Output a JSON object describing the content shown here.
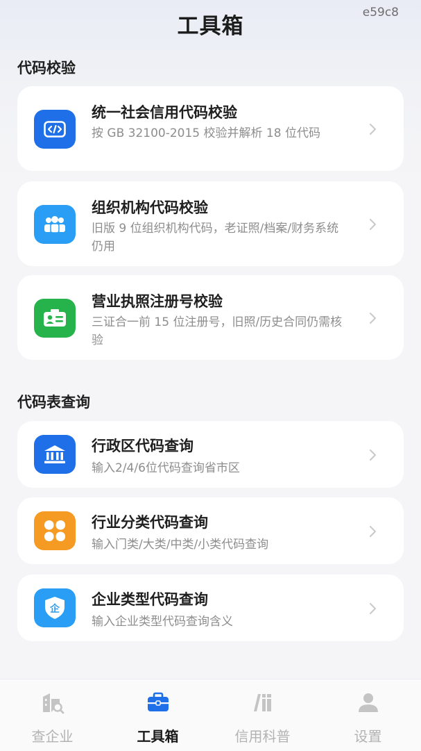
{
  "header": {
    "title": "工具箱",
    "corner_code": "e59c8"
  },
  "sections": [
    {
      "title": "代码校验",
      "items": [
        {
          "title": "统一社会信用代码校验",
          "desc": "按 GB 32100-2015 校验并解析 18 位代码",
          "icon": "code-icon"
        },
        {
          "title": "组织机构代码校验",
          "desc": "旧版 9 位组织机构代码，老证照/档案/财务系统仍用",
          "icon": "users-icon"
        },
        {
          "title": "营业执照注册号校验",
          "desc": "三证合一前 15 位注册号，旧照/历史合同仍需核验",
          "icon": "id-card-icon"
        }
      ]
    },
    {
      "title": "代码表查询",
      "items": [
        {
          "title": "行政区代码查询",
          "desc": "输入2/4/6位代码查询省市区",
          "icon": "government-icon"
        },
        {
          "title": "行业分类代码查询",
          "desc": "输入门类/大类/中类/小类代码查询",
          "icon": "category-icon"
        },
        {
          "title": "企业类型代码查询",
          "desc": "输入企业类型代码查询含义",
          "icon": "shield-enterprise-icon"
        }
      ]
    }
  ],
  "icon_labels": {
    "enterprise_glyph": "企"
  },
  "tabs": [
    {
      "label": "查企业",
      "icon": "search-company-icon",
      "active": false
    },
    {
      "label": "工具箱",
      "icon": "toolbox-icon",
      "active": true
    },
    {
      "label": "信用科普",
      "icon": "books-icon",
      "active": false
    },
    {
      "label": "设置",
      "icon": "user-icon",
      "active": false
    }
  ],
  "colors": {
    "blue": "#1e6fe8",
    "sky": "#2a9df4",
    "green": "#27b34b",
    "orange": "#f59a23",
    "active_tab": "#1e6fe8",
    "inactive_tab": "#b9b9b9"
  }
}
